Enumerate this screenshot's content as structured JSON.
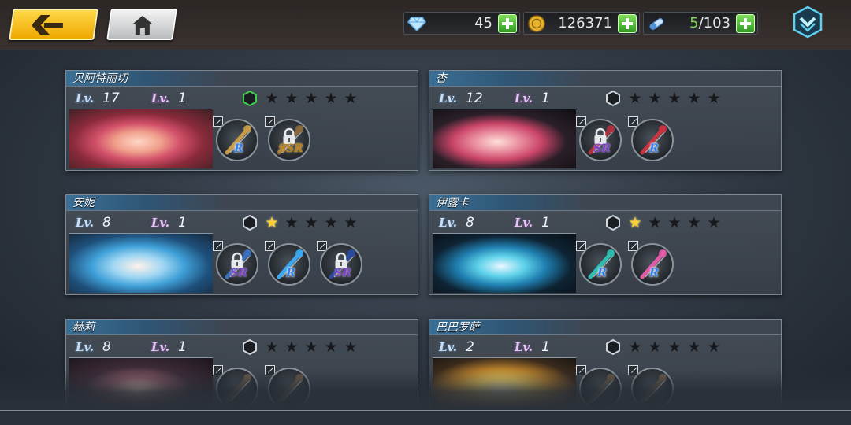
{
  "topbar": {
    "back_icon": "chevron-left-icon",
    "home_icon": "home-icon",
    "menu_icon": "chevron-down-shield-icon",
    "resources": [
      {
        "icon": "diamond-icon",
        "value": "45"
      },
      {
        "icon": "gold-coin-icon",
        "value": "126371"
      },
      {
        "icon": "stamina-icon",
        "current": "5",
        "separator": "/",
        "max": "103"
      }
    ]
  },
  "lv_label": "Lv.",
  "characters": [
    {
      "name": "贝阿特丽切",
      "level": "17",
      "sub_level": "1",
      "stars": 0,
      "hex_active": true,
      "weapons": [
        {
          "rarity": "R",
          "locked": false,
          "color": "#c79b47"
        },
        {
          "rarity": "SSR",
          "locked": true,
          "color": "#8a6a3a"
        }
      ]
    },
    {
      "name": "杏",
      "level": "12",
      "sub_level": "1",
      "stars": 0,
      "hex_active": false,
      "weapons": [
        {
          "rarity": "SR",
          "locked": true,
          "color": "#b0303e"
        },
        {
          "rarity": "R",
          "locked": false,
          "color": "#c93340"
        }
      ]
    },
    {
      "name": "安妮",
      "level": "8",
      "sub_level": "1",
      "stars": 1,
      "hex_active": false,
      "weapons": [
        {
          "rarity": "SR",
          "locked": true,
          "color": "#3a6fbf"
        },
        {
          "rarity": "R",
          "locked": false,
          "color": "#3aa8f0"
        },
        {
          "rarity": "SR",
          "locked": true,
          "color": "#2a4aa0"
        }
      ]
    },
    {
      "name": "伊露卡",
      "level": "8",
      "sub_level": "1",
      "stars": 1,
      "hex_active": false,
      "weapons": [
        {
          "rarity": "R",
          "locked": false,
          "color": "#2fbdb0"
        },
        {
          "rarity": "R",
          "locked": false,
          "color": "#e05aa8"
        }
      ]
    },
    {
      "name": "赫莉",
      "level": "8",
      "sub_level": "1",
      "stars": 0,
      "hex_active": false,
      "weapons": [
        {
          "rarity": "",
          "locked": false,
          "color": "#6a5a4a"
        },
        {
          "rarity": "",
          "locked": false,
          "color": "#6a5a4a"
        }
      ]
    },
    {
      "name": "巴巴罗萨",
      "level": "2",
      "sub_level": "1",
      "stars": 0,
      "hex_active": false,
      "weapons": [
        {
          "rarity": "",
          "locked": false,
          "color": "#6a5a4a"
        },
        {
          "rarity": "",
          "locked": false,
          "color": "#6a5a4a"
        }
      ]
    }
  ],
  "colors": {
    "back_button": "#f5b800",
    "hex_active": "#3fd34a",
    "star_on": "#ffcf3a",
    "rarity_R": "#2c7df0",
    "rarity_SR": "#7b3ec7",
    "rarity_SSR": "#b7801c"
  }
}
